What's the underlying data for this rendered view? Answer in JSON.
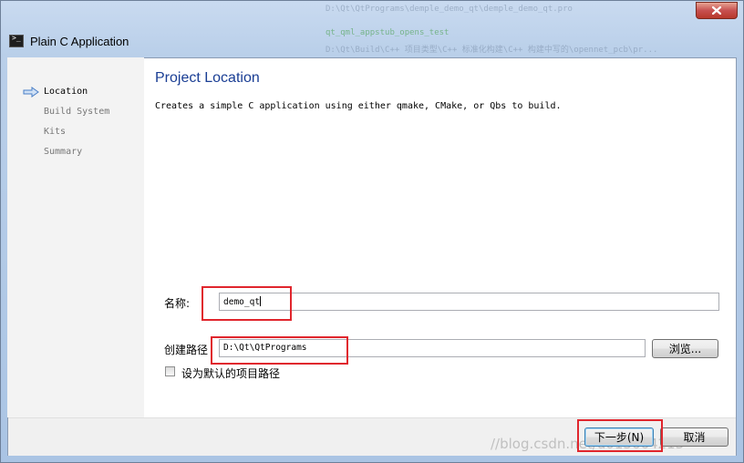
{
  "background": {
    "line1": "D:\\Qt\\QtPrograms\\demple_demo_qt\\demple_demo_qt.pro",
    "line2": "qt_qml_appstub_opens_test",
    "line3": "D:\\Qt\\Build\\C++  项目类型\\C++  标准化构建\\C++  构建中写的\\opennet_pcb\\pr..."
  },
  "window": {
    "title": "Plain C Application",
    "close_icon": "close-icon"
  },
  "sidebar": {
    "steps": [
      {
        "label": "Location",
        "active": true
      },
      {
        "label": "Build System",
        "active": false
      },
      {
        "label": "Kits",
        "active": false
      },
      {
        "label": "Summary",
        "active": false
      }
    ]
  },
  "main": {
    "title": "Project Location",
    "description": "Creates a simple C application using either qmake, CMake, or Qbs to build.",
    "name_label": "名称:",
    "name_value": "demo_qt",
    "path_label": "创建路径",
    "path_value": "D:\\Qt\\QtPrograms",
    "browse_label": "浏览...",
    "default_checkbox_label": "设为默认的项目路径",
    "default_checked": false
  },
  "footer": {
    "next_label": "下一步(N)",
    "cancel_label": "取消"
  },
  "watermark": "//blog.csdn.net/u013664213",
  "colors": {
    "title_accent": "#1a3e94",
    "highlight": "#e0262d",
    "arrow": "#4a7fc7"
  }
}
